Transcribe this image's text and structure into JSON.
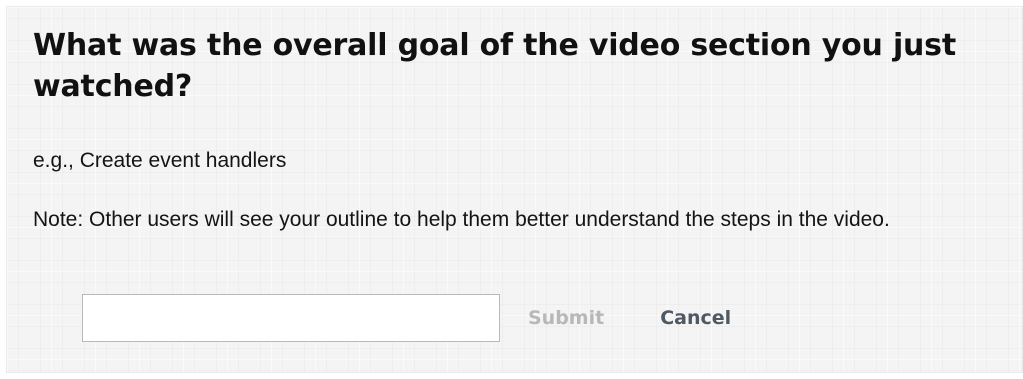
{
  "prompt": {
    "question": "What was the overall goal of the video section you just watched?",
    "example": "e.g., Create event handlers",
    "note": "Note: Other users will see your outline to help them better understand the steps in the video."
  },
  "form": {
    "input_value": "",
    "input_placeholder": "",
    "submit_label": "Submit",
    "cancel_label": "Cancel"
  },
  "colors": {
    "panel_background": "#f4f4f4",
    "submit_disabled": "#b8b8b8",
    "cancel_link": "#4f5964",
    "input_border": "#b9b9b9"
  }
}
